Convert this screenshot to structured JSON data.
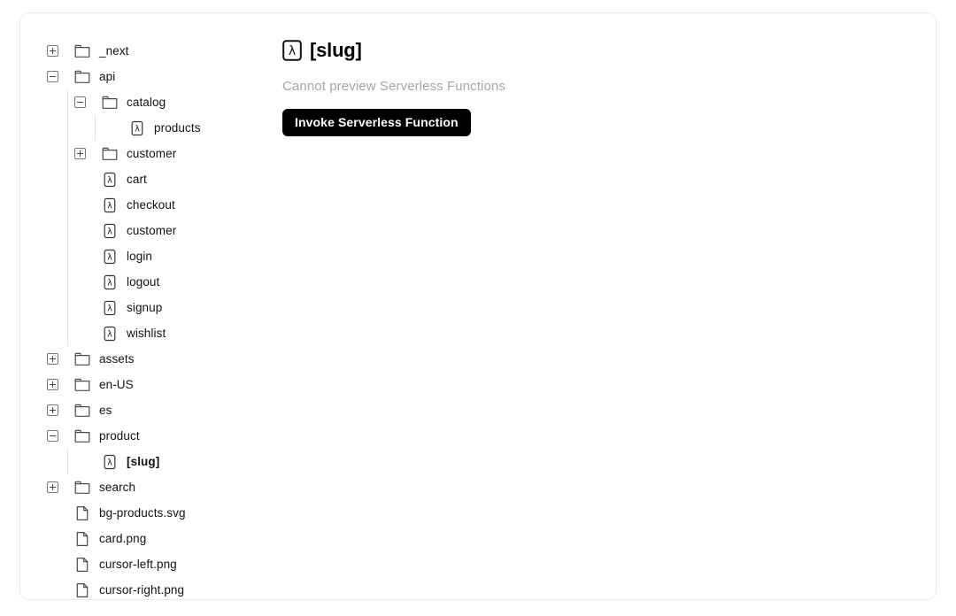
{
  "pane": {
    "icon": "lambda-function-icon",
    "title": "[slug]",
    "subtitle": "Cannot preview Serverless Functions",
    "invoke_label": "Invoke Serverless Function"
  },
  "theme": {
    "background": "#ffffff",
    "card_border": "#eaeaea",
    "text": "#111111",
    "muted_text": "#a6a6a6",
    "button_bg": "#000000",
    "button_text": "#ffffff",
    "rail": "#e3e3e3"
  },
  "tree": {
    "items": [
      {
        "label": "_next",
        "type": "folder",
        "depth": 0,
        "toggle": "plus",
        "selected": false,
        "icon": "folder-icon"
      },
      {
        "label": "api",
        "type": "folder",
        "depth": 0,
        "toggle": "minus",
        "selected": false,
        "icon": "folder-icon"
      },
      {
        "label": "catalog",
        "type": "folder",
        "depth": 1,
        "toggle": "minus",
        "selected": false,
        "icon": "folder-icon"
      },
      {
        "label": "products",
        "type": "function",
        "depth": 2,
        "toggle": "none",
        "selected": false,
        "icon": "lambda-function-icon"
      },
      {
        "label": "customer",
        "type": "folder",
        "depth": 1,
        "toggle": "plus",
        "selected": false,
        "icon": "folder-icon"
      },
      {
        "label": "cart",
        "type": "function",
        "depth": 1,
        "toggle": "none",
        "selected": false,
        "icon": "lambda-function-icon"
      },
      {
        "label": "checkout",
        "type": "function",
        "depth": 1,
        "toggle": "none",
        "selected": false,
        "icon": "lambda-function-icon"
      },
      {
        "label": "customer",
        "type": "function",
        "depth": 1,
        "toggle": "none",
        "selected": false,
        "icon": "lambda-function-icon"
      },
      {
        "label": "login",
        "type": "function",
        "depth": 1,
        "toggle": "none",
        "selected": false,
        "icon": "lambda-function-icon"
      },
      {
        "label": "logout",
        "type": "function",
        "depth": 1,
        "toggle": "none",
        "selected": false,
        "icon": "lambda-function-icon"
      },
      {
        "label": "signup",
        "type": "function",
        "depth": 1,
        "toggle": "none",
        "selected": false,
        "icon": "lambda-function-icon"
      },
      {
        "label": "wishlist",
        "type": "function",
        "depth": 1,
        "toggle": "none",
        "selected": false,
        "icon": "lambda-function-icon"
      },
      {
        "label": "assets",
        "type": "folder",
        "depth": 0,
        "toggle": "plus",
        "selected": false,
        "icon": "folder-icon"
      },
      {
        "label": "en-US",
        "type": "folder",
        "depth": 0,
        "toggle": "plus",
        "selected": false,
        "icon": "folder-icon"
      },
      {
        "label": "es",
        "type": "folder",
        "depth": 0,
        "toggle": "plus",
        "selected": false,
        "icon": "folder-icon"
      },
      {
        "label": "product",
        "type": "folder",
        "depth": 0,
        "toggle": "minus",
        "selected": false,
        "icon": "folder-icon"
      },
      {
        "label": "[slug]",
        "type": "function",
        "depth": 1,
        "toggle": "none",
        "selected": true,
        "icon": "lambda-function-icon"
      },
      {
        "label": "search",
        "type": "folder",
        "depth": 0,
        "toggle": "plus",
        "selected": false,
        "icon": "folder-icon"
      },
      {
        "label": "bg-products.svg",
        "type": "file",
        "depth": 0,
        "toggle": "none",
        "selected": false,
        "icon": "file-icon"
      },
      {
        "label": "card.png",
        "type": "file",
        "depth": 0,
        "toggle": "none",
        "selected": false,
        "icon": "file-icon"
      },
      {
        "label": "cursor-left.png",
        "type": "file",
        "depth": 0,
        "toggle": "none",
        "selected": false,
        "icon": "file-icon"
      },
      {
        "label": "cursor-right.png",
        "type": "file",
        "depth": 0,
        "toggle": "none",
        "selected": false,
        "icon": "file-icon"
      }
    ]
  }
}
